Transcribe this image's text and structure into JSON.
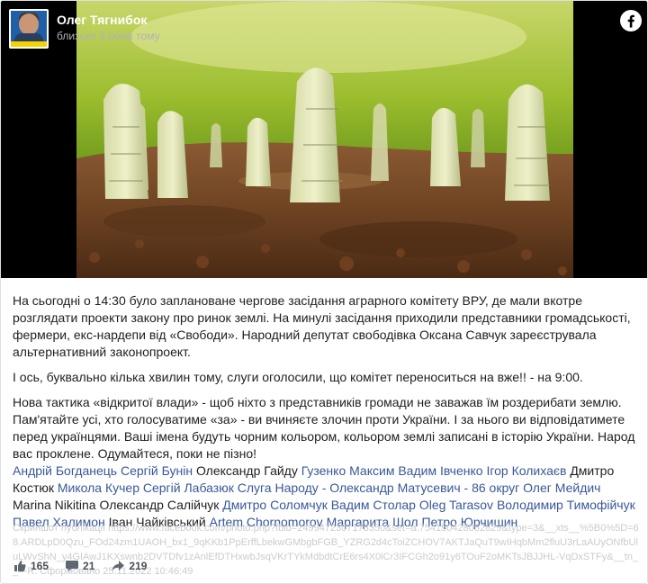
{
  "post": {
    "author": "Олег Тягнибок",
    "time": "близько 3 років тому",
    "paragraphs": [
      "На сьогодні о 14:30 було заплановане чергове засідання аграрного комітету ВРУ, де мали вкотре розглядати проекти закону про ринок землі. На минулі засідання приходили представники громадськості, фермери, екс-нардепи від «Свободи». Народний депутат свободівка Оксана Савчук зареєструвала альтернативний законопроект.",
      "І ось, буквально кілька хвилин тому, слуги оголосили, що комітет переноситься на вже!! - на 9:00.",
      "Нова тактика «відкритої влади» - щоб ніхто з представників громади не заважав їм роздерибати землю. Пам'ятайте усі, хто голосуватиме «за» - ви вчиняєте злочин проти України. І за нього ви відповідатимете перед українцями. Ваші імена будуть чорним кольором, кольором землі записані в історію України. Народ вас проклене. Одумайтеся, поки не пізно!"
    ],
    "tags": [
      {
        "text": "Андрій Богданець",
        "link": true
      },
      {
        "text": "Сергій Бунін",
        "link": true
      },
      {
        "text": "Олександр Гайду",
        "link": false
      },
      {
        "text": "Гузенко Максим",
        "link": true
      },
      {
        "text": "Вадим Івченко",
        "link": true
      },
      {
        "text": "Ігор Колихаєв",
        "link": true
      },
      {
        "text": "Дмитро Костюк",
        "link": false
      },
      {
        "text": "Микола Кучер",
        "link": true
      },
      {
        "text": "Сергій Лабазюк",
        "link": true
      },
      {
        "text": "Слуга Народу - Олександр Матусевич - 86 округ",
        "link": true
      },
      {
        "text": "Олег Мейдич",
        "link": true
      },
      {
        "text": "Marina Nikitina",
        "link": false
      },
      {
        "text": "Олександр Салійчук",
        "link": false
      },
      {
        "text": "Дмитро Соломчук",
        "link": true
      },
      {
        "text": "Вадим Столар",
        "link": true
      },
      {
        "text": "Oleg Tarasov",
        "link": true
      },
      {
        "text": "Володимир Тимофійчук",
        "link": true
      },
      {
        "text": "Павел Халимон",
        "link": true
      },
      {
        "text": "Іван Чайківський",
        "link": false
      },
      {
        "text": "Artem Chornomorov",
        "link": true
      },
      {
        "text": "Маргарита Шол",
        "link": true
      },
      {
        "text": "Петро Юрчишин",
        "link": true
      }
    ],
    "overlay_text": "Скриншот публікації https://www.facebook.com/photo.php?fbid=2499472307173350&set=a.754150428052829&type=3&__xts__%5B0%5D=68.ARDLpD0Qzu_FOd24zm1UAOH_bx1_9qKKb1PpErffLbekwGMbgbFGB_YZRG2d4cToiZCHOV7AKTJaQuT9wIHqbMm2fluU3rLaAUyONfbUluLWvShN_y4GIAwJ1KXswnb2DVTDfv1zAnlEfDTHxwbJsqVKrTYkMdbdtCrE6rs4X0lCr3IFCGh2o91y6TOuF2oMKTsJBJJHL-VqDxSTFy&__tn__=-R. Сформовано 25.11.2022 10:46:49",
    "reactions": {
      "likes": "165",
      "comments": "21",
      "shares": "219"
    },
    "colors": {
      "link": "#385898",
      "text": "#1c1e21",
      "facebook_blue": "#1877f2"
    }
  }
}
